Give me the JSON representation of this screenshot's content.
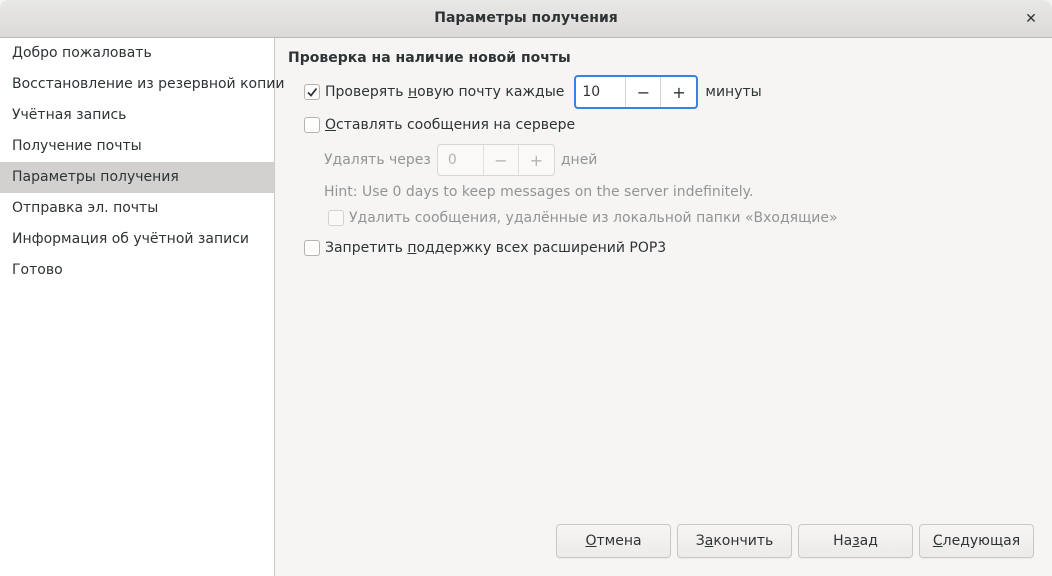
{
  "window": {
    "title": "Параметры получения"
  },
  "sidebar": {
    "items": [
      {
        "label": "Добро пожаловать"
      },
      {
        "label": "Восстановление из резервной копии"
      },
      {
        "label": "Учётная запись"
      },
      {
        "label": "Получение почты"
      },
      {
        "label": "Параметры получения",
        "active": true
      },
      {
        "label": "Отправка эл. почты"
      },
      {
        "label": "Информация об учётной записи"
      },
      {
        "label": "Готово"
      }
    ]
  },
  "main": {
    "section_title": "Проверка на наличие новой почты",
    "check_new": {
      "checked": true,
      "label_before": "Проверять ",
      "label_mnemonic": "н",
      "label_after": "овую почту каждые",
      "value": "10",
      "unit": "минуты"
    },
    "keep_on_server": {
      "checked": false,
      "label_mnemonic": "О",
      "label_after": "ставлять сообщения на сервере"
    },
    "delete_after": {
      "label": "Удалять через",
      "value": "0",
      "unit": "дней"
    },
    "hint": "Hint: Use 0 days to keep messages on the server indefinitely.",
    "delete_local": {
      "checked": false,
      "label": "Удалить сообщения, удалённые из локальной папки «Входящие»"
    },
    "disable_pop3": {
      "checked": false,
      "label_before": "Запретить ",
      "label_mnemonic": "п",
      "label_after": "оддержку всех расширений POP3"
    }
  },
  "buttons": {
    "cancel": {
      "mnemonic": "О",
      "rest": "тмена"
    },
    "finish": {
      "before": "З",
      "mnemonic": "а",
      "rest": "кончить"
    },
    "back": {
      "before": "На",
      "mnemonic": "з",
      "rest": "ад"
    },
    "next": {
      "mnemonic": "С",
      "rest": "ледующая"
    }
  },
  "colors": {
    "accent": "#3584e4",
    "sidebar_active": "#d2d1d0"
  }
}
